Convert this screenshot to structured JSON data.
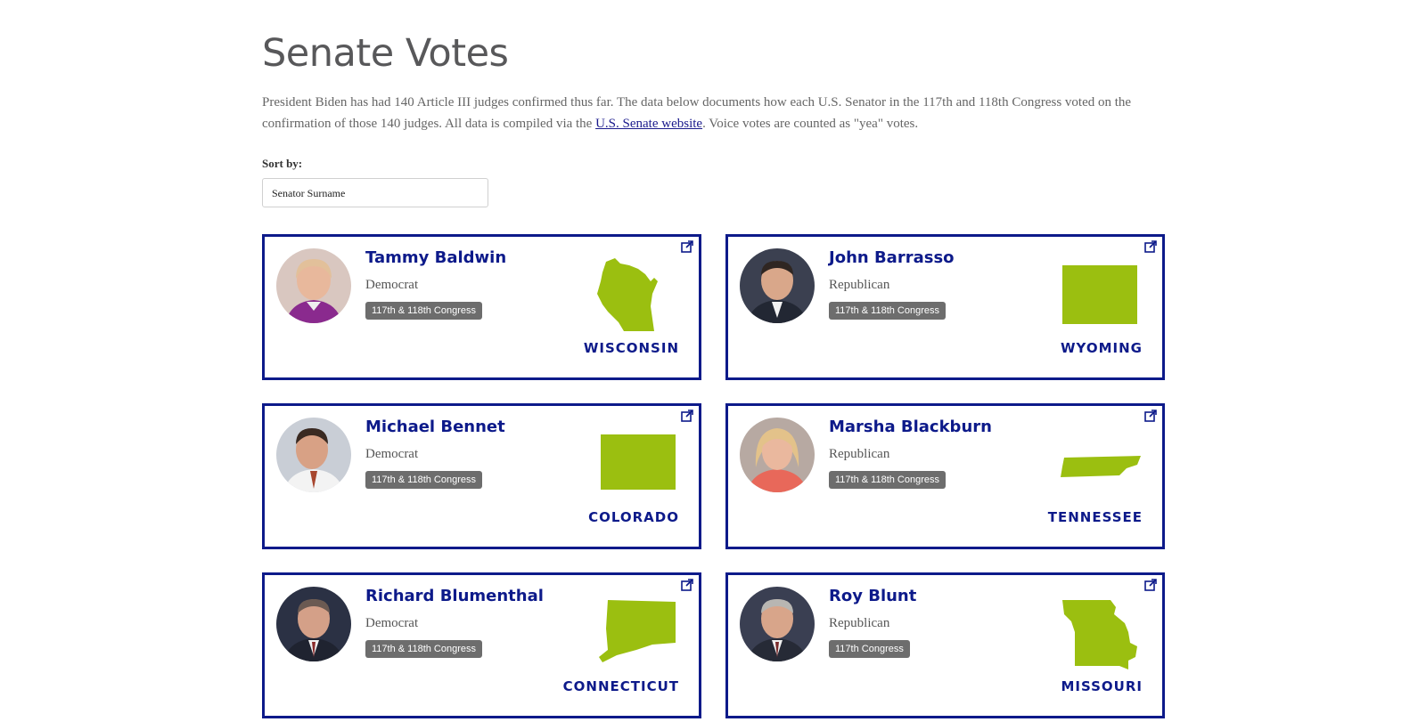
{
  "page": {
    "title": "Senate Votes",
    "intro_before": "President Biden has had 140 Article III judges confirmed thus far. The data below documents how each U.S. Senator in the 117th and 118th Congress voted on the confirmation of those 140 judges. All data is compiled via the ",
    "intro_link": "U.S. Senate website",
    "intro_after": ". Voice votes are counted as \"yea\" votes.",
    "sort_label": "Sort by:",
    "sort_value": "Senator Surname"
  },
  "colors": {
    "accent": "#0d1a8a",
    "state": "#9bbf10",
    "badge": "#6d6d6d"
  },
  "senators": [
    {
      "name": "Tammy Baldwin",
      "party": "Democrat",
      "congress": "117th & 118th Congress",
      "state": "WISCONSIN",
      "icon": "external-link-icon"
    },
    {
      "name": "John Barrasso",
      "party": "Republican",
      "congress": "117th & 118th Congress",
      "state": "WYOMING",
      "icon": "external-link-icon"
    },
    {
      "name": "Michael Bennet",
      "party": "Democrat",
      "congress": "117th & 118th Congress",
      "state": "COLORADO",
      "icon": "external-link-icon"
    },
    {
      "name": "Marsha Blackburn",
      "party": "Republican",
      "congress": "117th & 118th Congress",
      "state": "TENNESSEE",
      "icon": "external-link-icon"
    },
    {
      "name": "Richard Blumenthal",
      "party": "Democrat",
      "congress": "117th & 118th Congress",
      "state": "CONNECTICUT",
      "icon": "external-link-icon"
    },
    {
      "name": "Roy Blunt",
      "party": "Republican",
      "congress": "117th Congress",
      "state": "MISSOURI",
      "icon": "external-link-icon"
    }
  ]
}
